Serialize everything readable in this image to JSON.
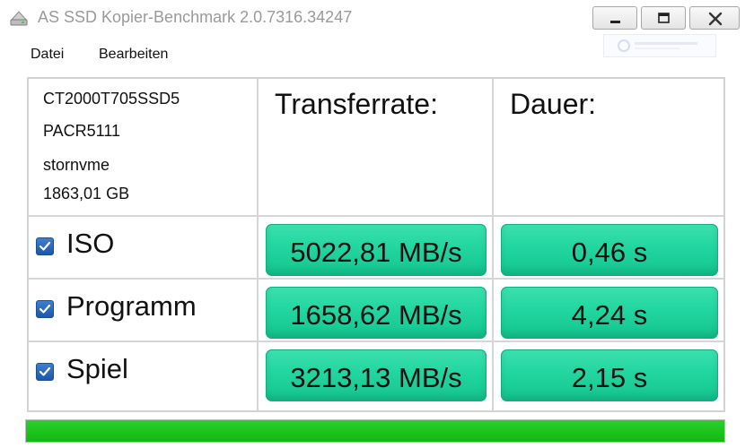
{
  "window": {
    "title": "AS SSD Kopier-Benchmark 2.0.7316.34247",
    "icon": "drive-icon",
    "controls": [
      "minimize-icon",
      "maximize-icon",
      "close-icon"
    ]
  },
  "menu": {
    "items": [
      {
        "label": "Datei"
      },
      {
        "label": "Bearbeiten"
      }
    ]
  },
  "drive": {
    "model": "CT2000T705SSD5",
    "firmware": "PACR5111",
    "driver": "stornvme",
    "capacity": "1863,01 GB"
  },
  "headers": {
    "transfer": "Transferrate:",
    "duration": "Dauer:"
  },
  "rows": [
    {
      "label": "ISO",
      "checked": true,
      "transfer": "5022,81 MB/s",
      "duration": "0,46 s"
    },
    {
      "label": "Programm",
      "checked": true,
      "transfer": "1658,62 MB/s",
      "duration": "4,24 s"
    },
    {
      "label": "Spiel",
      "checked": true,
      "transfer": "3213,13 MB/s",
      "duration": "2,15 s"
    }
  ],
  "progress": {
    "fraction": 1.0
  },
  "colors": {
    "result_fill": "#22d6a0",
    "progress_fill": "#10b810",
    "checkbox": "#1c56a8"
  }
}
